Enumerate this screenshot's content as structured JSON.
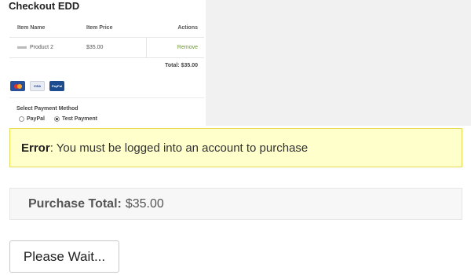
{
  "checkout": {
    "title": "Checkout EDD",
    "table": {
      "headers": [
        "Item Name",
        "Item Price",
        "Actions"
      ],
      "rows": [
        {
          "name": "Product 2",
          "price": "$35.00",
          "action": "Remove"
        }
      ],
      "total": "Total: $35.00"
    },
    "payment_icons": [
      "mastercard-icon",
      "visa-icon",
      "paypal-icon"
    ],
    "payment_icon_text": {
      "visa": "VISA",
      "paypal": "PayPal"
    },
    "payment_method": {
      "label": "Select Payment Method",
      "options": [
        {
          "label": "PayPal",
          "selected": false
        },
        {
          "label": "Test Payment",
          "selected": true
        }
      ]
    }
  },
  "error": {
    "prefix": "Error",
    "message": ": You must be logged into an account to purchase"
  },
  "purchase": {
    "label": "Purchase Total:",
    "amount": "$35.00"
  },
  "button": {
    "label": "Please Wait..."
  },
  "colors": {
    "error_bg": "#ffffcc",
    "error_border": "#e6db55",
    "remove_link": "#6a9a22"
  }
}
